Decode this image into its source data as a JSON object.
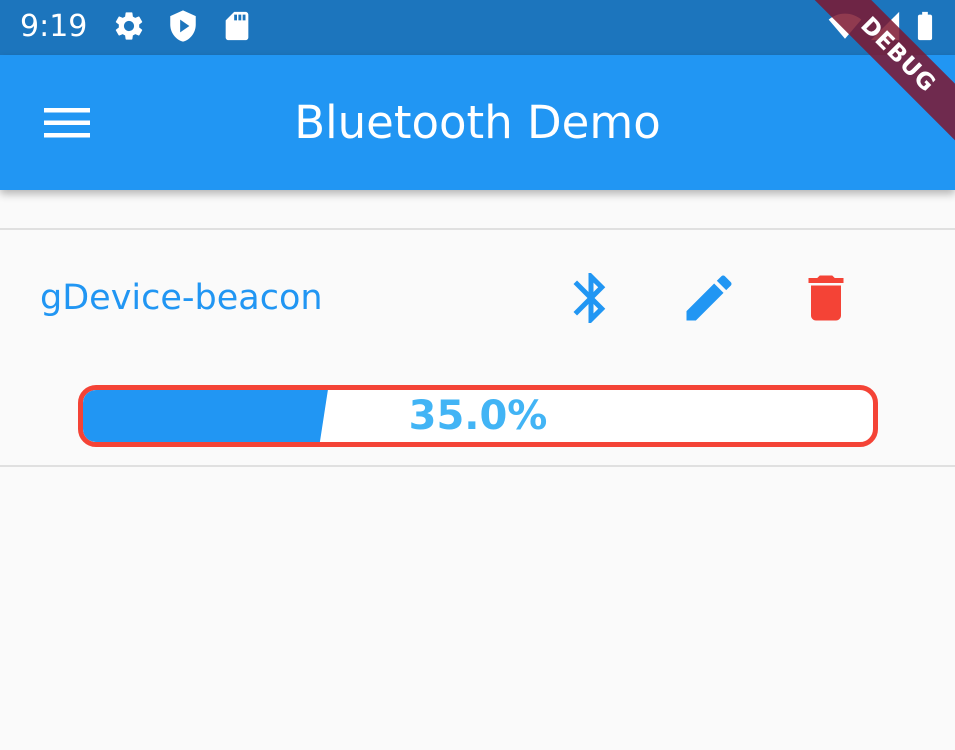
{
  "status_bar": {
    "time": "9:19",
    "icons": [
      "settings-icon",
      "shield-play-icon",
      "sd-card-icon",
      "wifi-icon",
      "signal-icon",
      "battery-icon"
    ]
  },
  "app_bar": {
    "title": "Bluetooth Demo",
    "menu_icon": "menu-icon",
    "debug_label": "DEBUG"
  },
  "device": {
    "name": "gDevice-beacon",
    "actions": [
      {
        "icon": "bluetooth-icon",
        "color": "#2196f3"
      },
      {
        "icon": "edit-icon",
        "color": "#2196f3"
      },
      {
        "icon": "delete-icon",
        "color": "#f44336"
      }
    ]
  },
  "progress": {
    "fraction": 0.31,
    "label": "35.0%",
    "fill_color": "#2196f3",
    "border_color": "#f44336",
    "label_color": "#42b4f5"
  },
  "colors": {
    "primary": "#2196f3",
    "primary_dark": "#1c75bd",
    "danger": "#f44336",
    "background": "#fafafa"
  }
}
